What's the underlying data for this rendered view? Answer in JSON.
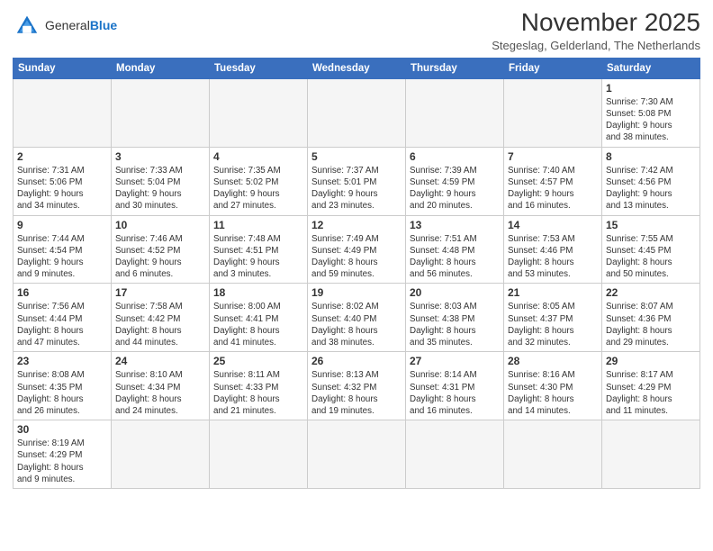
{
  "header": {
    "logo_general": "General",
    "logo_blue": "Blue",
    "month_title": "November 2025",
    "subtitle": "Stegeslag, Gelderland, The Netherlands"
  },
  "weekdays": [
    "Sunday",
    "Monday",
    "Tuesday",
    "Wednesday",
    "Thursday",
    "Friday",
    "Saturday"
  ],
  "weeks": [
    [
      {
        "day": "",
        "info": ""
      },
      {
        "day": "",
        "info": ""
      },
      {
        "day": "",
        "info": ""
      },
      {
        "day": "",
        "info": ""
      },
      {
        "day": "",
        "info": ""
      },
      {
        "day": "",
        "info": ""
      },
      {
        "day": "1",
        "info": "Sunrise: 7:30 AM\nSunset: 5:08 PM\nDaylight: 9 hours\nand 38 minutes."
      }
    ],
    [
      {
        "day": "2",
        "info": "Sunrise: 7:31 AM\nSunset: 5:06 PM\nDaylight: 9 hours\nand 34 minutes."
      },
      {
        "day": "3",
        "info": "Sunrise: 7:33 AM\nSunset: 5:04 PM\nDaylight: 9 hours\nand 30 minutes."
      },
      {
        "day": "4",
        "info": "Sunrise: 7:35 AM\nSunset: 5:02 PM\nDaylight: 9 hours\nand 27 minutes."
      },
      {
        "day": "5",
        "info": "Sunrise: 7:37 AM\nSunset: 5:01 PM\nDaylight: 9 hours\nand 23 minutes."
      },
      {
        "day": "6",
        "info": "Sunrise: 7:39 AM\nSunset: 4:59 PM\nDaylight: 9 hours\nand 20 minutes."
      },
      {
        "day": "7",
        "info": "Sunrise: 7:40 AM\nSunset: 4:57 PM\nDaylight: 9 hours\nand 16 minutes."
      },
      {
        "day": "8",
        "info": "Sunrise: 7:42 AM\nSunset: 4:56 PM\nDaylight: 9 hours\nand 13 minutes."
      }
    ],
    [
      {
        "day": "9",
        "info": "Sunrise: 7:44 AM\nSunset: 4:54 PM\nDaylight: 9 hours\nand 9 minutes."
      },
      {
        "day": "10",
        "info": "Sunrise: 7:46 AM\nSunset: 4:52 PM\nDaylight: 9 hours\nand 6 minutes."
      },
      {
        "day": "11",
        "info": "Sunrise: 7:48 AM\nSunset: 4:51 PM\nDaylight: 9 hours\nand 3 minutes."
      },
      {
        "day": "12",
        "info": "Sunrise: 7:49 AM\nSunset: 4:49 PM\nDaylight: 8 hours\nand 59 minutes."
      },
      {
        "day": "13",
        "info": "Sunrise: 7:51 AM\nSunset: 4:48 PM\nDaylight: 8 hours\nand 56 minutes."
      },
      {
        "day": "14",
        "info": "Sunrise: 7:53 AM\nSunset: 4:46 PM\nDaylight: 8 hours\nand 53 minutes."
      },
      {
        "day": "15",
        "info": "Sunrise: 7:55 AM\nSunset: 4:45 PM\nDaylight: 8 hours\nand 50 minutes."
      }
    ],
    [
      {
        "day": "16",
        "info": "Sunrise: 7:56 AM\nSunset: 4:44 PM\nDaylight: 8 hours\nand 47 minutes."
      },
      {
        "day": "17",
        "info": "Sunrise: 7:58 AM\nSunset: 4:42 PM\nDaylight: 8 hours\nand 44 minutes."
      },
      {
        "day": "18",
        "info": "Sunrise: 8:00 AM\nSunset: 4:41 PM\nDaylight: 8 hours\nand 41 minutes."
      },
      {
        "day": "19",
        "info": "Sunrise: 8:02 AM\nSunset: 4:40 PM\nDaylight: 8 hours\nand 38 minutes."
      },
      {
        "day": "20",
        "info": "Sunrise: 8:03 AM\nSunset: 4:38 PM\nDaylight: 8 hours\nand 35 minutes."
      },
      {
        "day": "21",
        "info": "Sunrise: 8:05 AM\nSunset: 4:37 PM\nDaylight: 8 hours\nand 32 minutes."
      },
      {
        "day": "22",
        "info": "Sunrise: 8:07 AM\nSunset: 4:36 PM\nDaylight: 8 hours\nand 29 minutes."
      }
    ],
    [
      {
        "day": "23",
        "info": "Sunrise: 8:08 AM\nSunset: 4:35 PM\nDaylight: 8 hours\nand 26 minutes."
      },
      {
        "day": "24",
        "info": "Sunrise: 8:10 AM\nSunset: 4:34 PM\nDaylight: 8 hours\nand 24 minutes."
      },
      {
        "day": "25",
        "info": "Sunrise: 8:11 AM\nSunset: 4:33 PM\nDaylight: 8 hours\nand 21 minutes."
      },
      {
        "day": "26",
        "info": "Sunrise: 8:13 AM\nSunset: 4:32 PM\nDaylight: 8 hours\nand 19 minutes."
      },
      {
        "day": "27",
        "info": "Sunrise: 8:14 AM\nSunset: 4:31 PM\nDaylight: 8 hours\nand 16 minutes."
      },
      {
        "day": "28",
        "info": "Sunrise: 8:16 AM\nSunset: 4:30 PM\nDaylight: 8 hours\nand 14 minutes."
      },
      {
        "day": "29",
        "info": "Sunrise: 8:17 AM\nSunset: 4:29 PM\nDaylight: 8 hours\nand 11 minutes."
      }
    ],
    [
      {
        "day": "30",
        "info": "Sunrise: 8:19 AM\nSunset: 4:29 PM\nDaylight: 8 hours\nand 9 minutes."
      },
      {
        "day": "",
        "info": ""
      },
      {
        "day": "",
        "info": ""
      },
      {
        "day": "",
        "info": ""
      },
      {
        "day": "",
        "info": ""
      },
      {
        "day": "",
        "info": ""
      },
      {
        "day": "",
        "info": ""
      }
    ]
  ]
}
